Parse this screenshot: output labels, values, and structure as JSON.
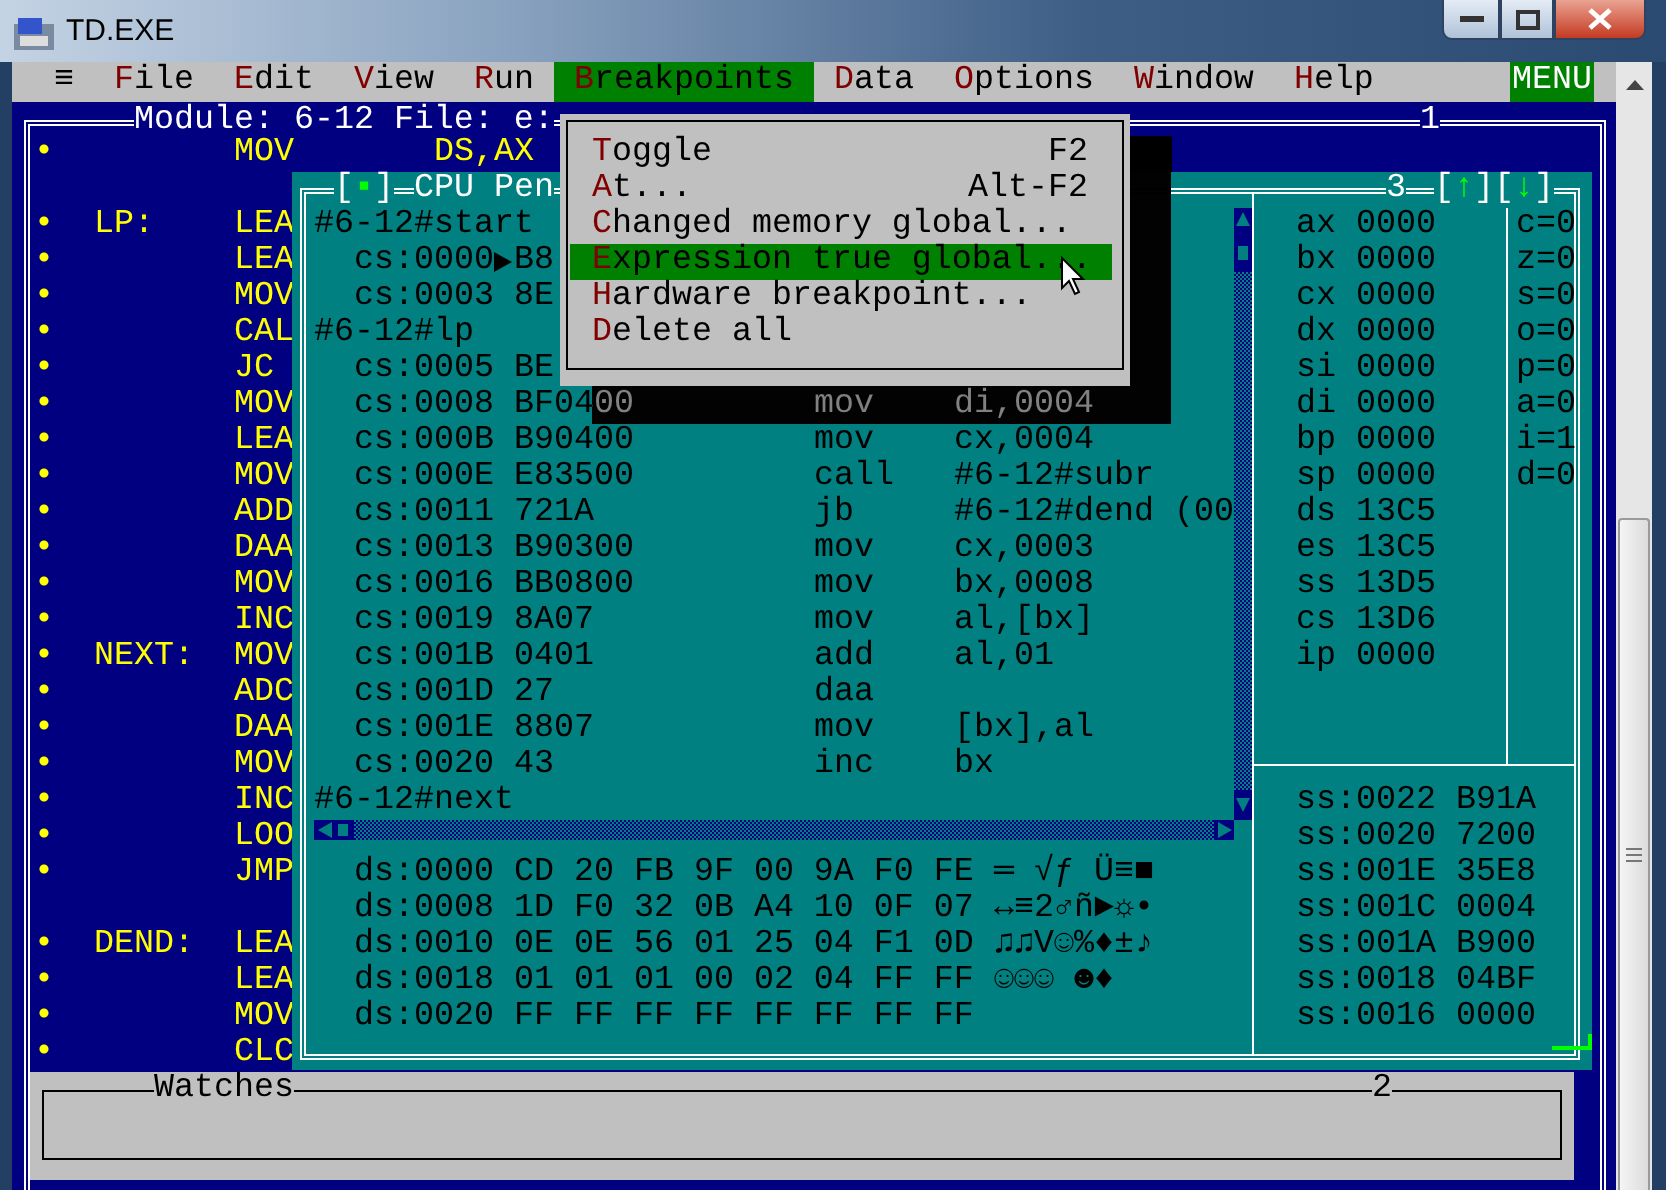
{
  "window": {
    "title": "TD.EXE"
  },
  "menu_bar": {
    "system_menu": "≡",
    "items": [
      {
        "label": "File",
        "selected": false
      },
      {
        "label": "Edit",
        "selected": false
      },
      {
        "label": "View",
        "selected": false
      },
      {
        "label": "Run",
        "selected": false
      },
      {
        "label": "Breakpoints",
        "selected": true
      },
      {
        "label": "Data",
        "selected": false
      },
      {
        "label": "Options",
        "selected": false
      },
      {
        "label": "Window",
        "selected": false
      },
      {
        "label": "Help",
        "selected": false
      }
    ],
    "mode": "MENU"
  },
  "module_window": {
    "title": "Module: 6-12 File: e:",
    "number": "1",
    "lines": [
      {
        "kind": "code",
        "marker": "•",
        "mnemonic": "MOV",
        "operand": "DS,AX"
      },
      {
        "kind": "blank"
      },
      {
        "kind": "code",
        "marker": "•",
        "label": "LP:",
        "mnemonic": "LEA"
      },
      {
        "kind": "code",
        "marker": "•",
        "mnemonic": "LEA"
      },
      {
        "kind": "code",
        "marker": "•",
        "mnemonic": "MOV"
      },
      {
        "kind": "code",
        "marker": "•",
        "mnemonic": "CAL"
      },
      {
        "kind": "code",
        "marker": "•",
        "mnemonic": "JC"
      },
      {
        "kind": "code",
        "marker": "•",
        "mnemonic": "MOV"
      },
      {
        "kind": "code",
        "marker": "•",
        "mnemonic": "LEA"
      },
      {
        "kind": "code",
        "marker": "•",
        "mnemonic": "MOV"
      },
      {
        "kind": "code",
        "marker": "•",
        "mnemonic": "ADD"
      },
      {
        "kind": "code",
        "marker": "•",
        "mnemonic": "DAA"
      },
      {
        "kind": "code",
        "marker": "•",
        "mnemonic": "MOV"
      },
      {
        "kind": "code",
        "marker": "•",
        "mnemonic": "INC"
      },
      {
        "kind": "code",
        "marker": "•",
        "label": "NEXT:",
        "mnemonic": "MOV"
      },
      {
        "kind": "code",
        "marker": "•",
        "mnemonic": "ADC"
      },
      {
        "kind": "code",
        "marker": "•",
        "mnemonic": "DAA"
      },
      {
        "kind": "code",
        "marker": "•",
        "mnemonic": "MOV"
      },
      {
        "kind": "code",
        "marker": "•",
        "mnemonic": "INC"
      },
      {
        "kind": "code",
        "marker": "•",
        "mnemonic": "LOO"
      },
      {
        "kind": "code",
        "marker": "•",
        "mnemonic": "JMP"
      },
      {
        "kind": "blank"
      },
      {
        "kind": "code",
        "marker": "•",
        "label": "DEND:",
        "mnemonic": "LEA"
      },
      {
        "kind": "code",
        "marker": "•",
        "mnemonic": "LEA"
      },
      {
        "kind": "code",
        "marker": "•",
        "mnemonic": "MOV"
      },
      {
        "kind": "code",
        "marker": "•",
        "mnemonic": "CLC"
      }
    ]
  },
  "cpu_window": {
    "close_box": "[▪]",
    "title": "CPU Pen",
    "number": "3",
    "zoom_buttons": [
      "[↑]",
      "[↓]"
    ],
    "disassembly": [
      {
        "kind": "label",
        "text": "#6-12#start"
      },
      {
        "kind": "instr",
        "address": "cs:0000",
        "current": true,
        "bytes": "B8"
      },
      {
        "kind": "instr",
        "address": "cs:0003",
        "current": false,
        "bytes": "8E"
      },
      {
        "kind": "label",
        "text": "#6-12#lp"
      },
      {
        "kind": "instr",
        "address": "cs:0005",
        "current": false,
        "bytes": "BE"
      },
      {
        "kind": "instr",
        "address": "cs:0008",
        "current": false,
        "bytes": "BF0400",
        "mnemonic": "mov",
        "operand": "di,0004"
      },
      {
        "kind": "instr",
        "address": "cs:000B",
        "current": false,
        "bytes": "B90400",
        "mnemonic": "mov",
        "operand": "cx,0004"
      },
      {
        "kind": "instr",
        "address": "cs:000E",
        "current": false,
        "bytes": "E83500",
        "mnemonic": "call",
        "operand": "#6-12#subr"
      },
      {
        "kind": "instr",
        "address": "cs:0011",
        "current": false,
        "bytes": "721A",
        "mnemonic": "jb",
        "operand": "#6-12#dend (00"
      },
      {
        "kind": "instr",
        "address": "cs:0013",
        "current": false,
        "bytes": "B90300",
        "mnemonic": "mov",
        "operand": "cx,0003"
      },
      {
        "kind": "instr",
        "address": "cs:0016",
        "current": false,
        "bytes": "BB0800",
        "mnemonic": "mov",
        "operand": "bx,0008"
      },
      {
        "kind": "instr",
        "address": "cs:0019",
        "current": false,
        "bytes": "8A07",
        "mnemonic": "mov",
        "operand": "al,[bx]"
      },
      {
        "kind": "instr",
        "address": "cs:001B",
        "current": false,
        "bytes": "0401",
        "mnemonic": "add",
        "operand": "al,01"
      },
      {
        "kind": "instr",
        "address": "cs:001D",
        "current": false,
        "bytes": "27",
        "mnemonic": "daa"
      },
      {
        "kind": "instr",
        "address": "cs:001E",
        "current": false,
        "bytes": "8807",
        "mnemonic": "mov",
        "operand": "[bx],al"
      },
      {
        "kind": "instr",
        "address": "cs:0020",
        "current": false,
        "bytes": "43",
        "mnemonic": "inc",
        "operand": "bx"
      },
      {
        "kind": "label",
        "text": "#6-12#next"
      }
    ],
    "dump": [
      {
        "address": "ds:0000",
        "bytes": "CD 20 FB 9F 00 9A F0 FE",
        "chars": "═ √ƒ Ü≡■"
      },
      {
        "address": "ds:0008",
        "bytes": "1D F0 32 0B A4 10 0F 07",
        "chars": "↔≡2♂ñ►☼•"
      },
      {
        "address": "ds:0010",
        "bytes": "0E 0E 56 01 25 04 F1 0D",
        "chars": "♫♫V☺%♦±♪"
      },
      {
        "address": "ds:0018",
        "bytes": "01 01 01 00 02 04 FF FF",
        "chars": "☺☺☺ ☻♦"
      },
      {
        "address": "ds:0020",
        "bytes": "FF FF FF FF FF FF FF FF"
      }
    ],
    "registers": [
      {
        "name": "ax",
        "value": "0000"
      },
      {
        "name": "bx",
        "value": "0000"
      },
      {
        "name": "cx",
        "value": "0000"
      },
      {
        "name": "dx",
        "value": "0000"
      },
      {
        "name": "si",
        "value": "0000"
      },
      {
        "name": "di",
        "value": "0000"
      },
      {
        "name": "bp",
        "value": "0000"
      },
      {
        "name": "sp",
        "value": "0000"
      },
      {
        "name": "ds",
        "value": "13C5"
      },
      {
        "name": "es",
        "value": "13C5"
      },
      {
        "name": "ss",
        "value": "13D5"
      },
      {
        "name": "cs",
        "value": "13D6"
      },
      {
        "name": "ip",
        "value": "0000"
      }
    ],
    "flags": [
      "c=0",
      "z=0",
      "s=0",
      "o=0",
      "p=0",
      "a=0",
      "i=1",
      "d=0"
    ],
    "stack": [
      {
        "address": "ss:0022",
        "value": "B91A"
      },
      {
        "address": "ss:0020",
        "value": "7200"
      },
      {
        "address": "ss:001E",
        "value": "35E8"
      },
      {
        "address": "ss:001C",
        "value": "0004"
      },
      {
        "address": "ss:001A",
        "value": "B900"
      },
      {
        "address": "ss:0018",
        "value": "04BF"
      },
      {
        "address": "ss:0016",
        "value": "0000"
      }
    ]
  },
  "breakpoints_menu": {
    "items": [
      {
        "label": "Toggle",
        "shortcut": "F2",
        "selected": false
      },
      {
        "label": "At...",
        "shortcut": "Alt-F2",
        "selected": false
      },
      {
        "label": "Changed memory global...",
        "selected": false
      },
      {
        "label": "Expression true global...",
        "selected": true
      },
      {
        "label": "Hardware breakpoint...",
        "selected": false
      },
      {
        "label": "Delete all",
        "selected": false
      }
    ]
  },
  "watches_window": {
    "title": "Watches",
    "number": "2"
  }
}
